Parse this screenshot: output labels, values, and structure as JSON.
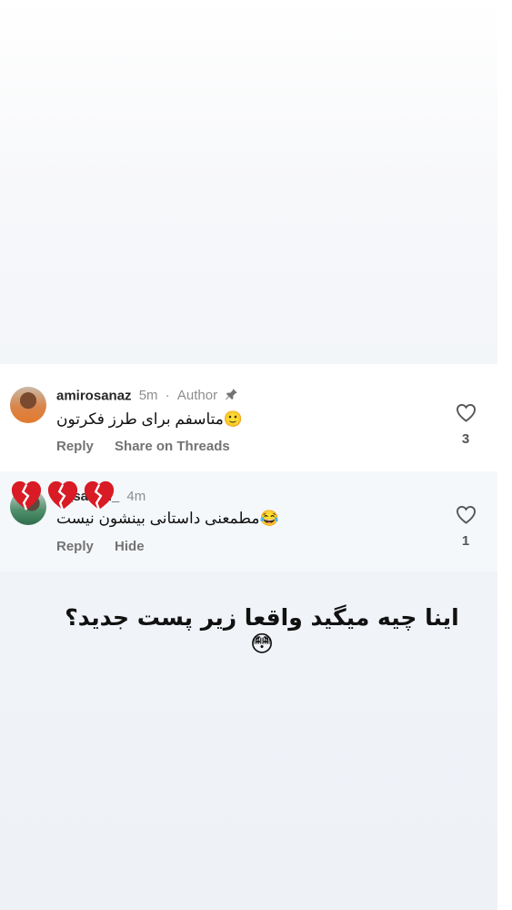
{
  "comments": [
    {
      "username": "amirosanaz",
      "time": "5m",
      "separator": "·",
      "badge": "Author",
      "text": "متاسفم برای طرز فکرتون🙂",
      "actions": [
        "Reply",
        "Share on Threads"
      ],
      "like_count": "3",
      "icons": [
        "avatar",
        "pin-icon",
        "heart-outline-icon"
      ]
    },
    {
      "username": "_salehi_",
      "time": "4m",
      "text": "مطمعنی داستانی بینشون نیست😂",
      "actions": [
        "Reply",
        "Hide"
      ],
      "like_count": "1",
      "icons": [
        "avatar",
        "broken-heart-icon",
        "heart-outline-icon"
      ]
    }
  ],
  "overlay": {
    "caption": "اینا چیه میگید واقعا زیر پست جدید؟😳",
    "stickers": [
      "broken-heart-emoji",
      "broken-heart-emoji",
      "broken-heart-emoji"
    ]
  },
  "colors": {
    "text": "#262626",
    "muted": "#8e8e8e",
    "heart": "#d81b24"
  }
}
